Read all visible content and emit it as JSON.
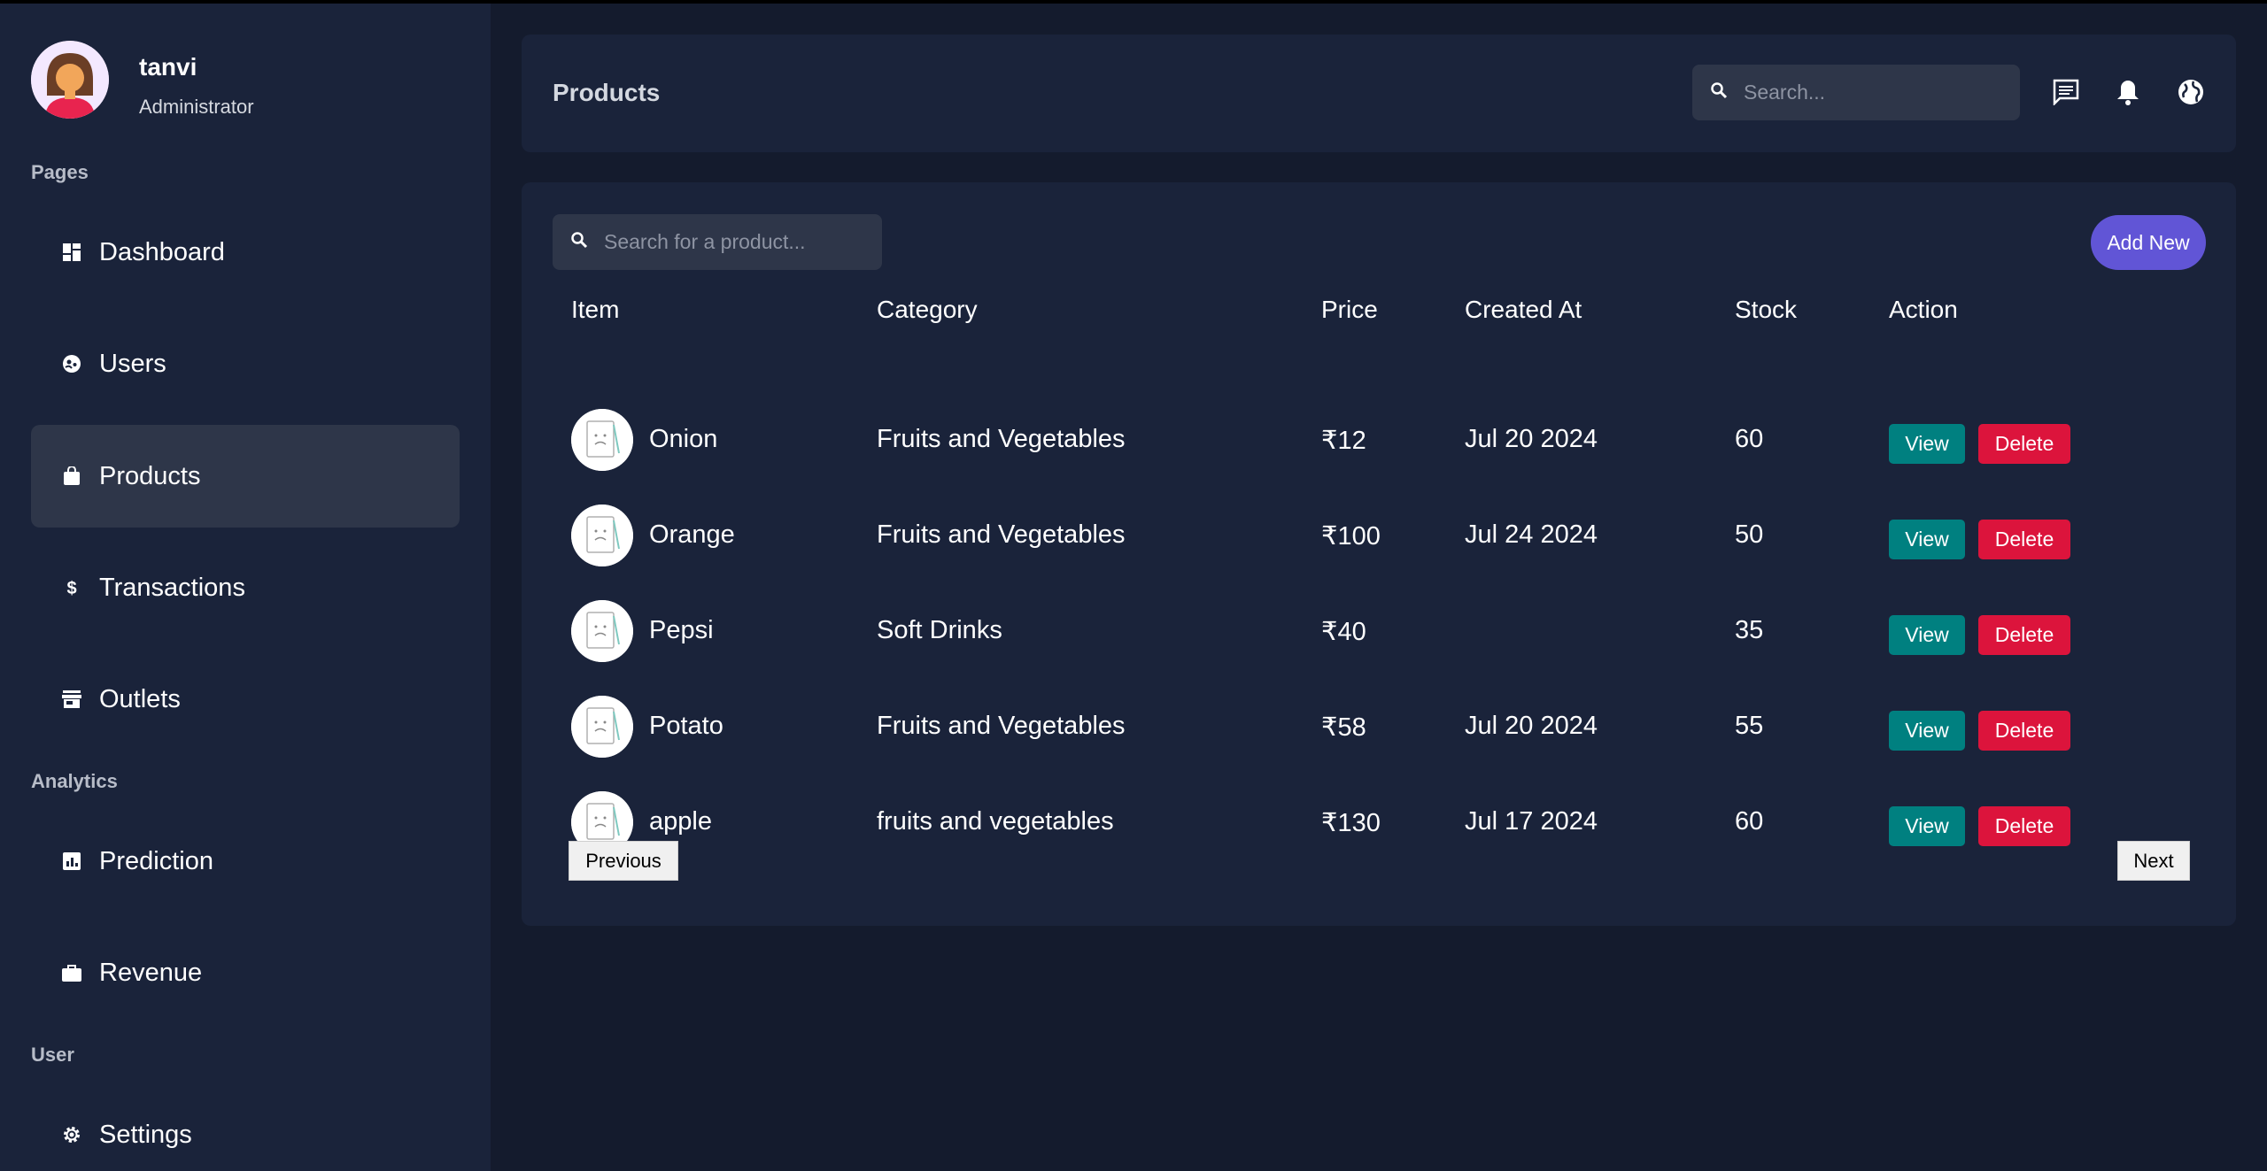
{
  "profile": {
    "name": "tanvi",
    "role": "Administrator",
    "avatar_icon": "user-avatar-icon"
  },
  "sidebar": {
    "sections": {
      "pages": "Pages",
      "analytics": "Analytics",
      "user": "User"
    },
    "items": [
      {
        "label": "Dashboard",
        "icon": "dashboard-icon",
        "active": false
      },
      {
        "label": "Users",
        "icon": "users-icon",
        "active": false
      },
      {
        "label": "Products",
        "icon": "shopping-bag-icon",
        "active": true
      },
      {
        "label": "Transactions",
        "icon": "dollar-icon",
        "active": false
      },
      {
        "label": "Outlets",
        "icon": "store-icon",
        "active": false
      },
      {
        "label": "Prediction",
        "icon": "bar-chart-icon",
        "active": false
      },
      {
        "label": "Revenue",
        "icon": "briefcase-icon",
        "active": false
      },
      {
        "label": "Settings",
        "icon": "gear-icon",
        "active": false
      }
    ]
  },
  "header": {
    "title": "Products",
    "search_placeholder": "Search...",
    "icons": [
      "chat-icon",
      "bell-icon",
      "globe-icon"
    ]
  },
  "products": {
    "search_placeholder": "Search for a product...",
    "add_new_label": "Add New",
    "columns": [
      "Item",
      "Category",
      "Price",
      "Created At",
      "Stock",
      "Action"
    ],
    "rows": [
      {
        "item": "Onion",
        "category": "Fruits and Vegetables",
        "price": "₹12",
        "created_at": "Jul 20 2024",
        "stock": "60"
      },
      {
        "item": "Orange",
        "category": "Fruits and Vegetables",
        "price": "₹100",
        "created_at": "Jul 24 2024",
        "stock": "50"
      },
      {
        "item": "Pepsi",
        "category": "Soft Drinks",
        "price": "₹40",
        "created_at": "",
        "stock": "35"
      },
      {
        "item": "Potato",
        "category": "Fruits and Vegetables",
        "price": "₹58",
        "created_at": "Jul 20 2024",
        "stock": "55"
      },
      {
        "item": "apple",
        "category": "fruits and vegetables",
        "price": "₹130",
        "created_at": "Jul 17 2024",
        "stock": "60"
      }
    ],
    "view_label": "View",
    "delete_label": "Delete",
    "previous_label": "Previous",
    "next_label": "Next"
  },
  "colors": {
    "sidebar_bg": "#1a233a",
    "page_bg": "#141b2d",
    "accent": "#6155d6",
    "view": "#008080",
    "delete": "#dc143c"
  }
}
